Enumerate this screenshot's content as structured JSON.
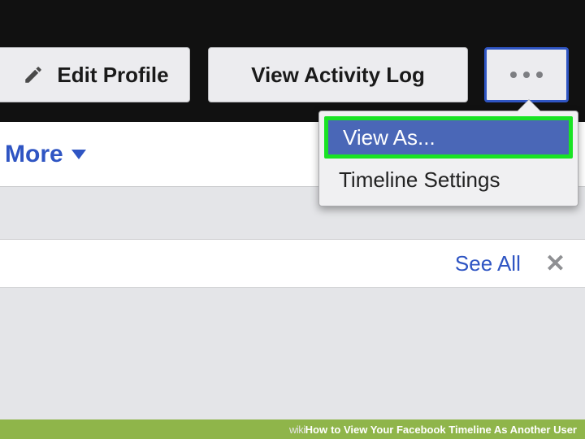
{
  "header": {
    "edit_label": "Edit Profile",
    "activity_label": "View Activity Log",
    "more_icon": "more-options",
    "pencil_icon": "pencil"
  },
  "tabs": {
    "more_label": "More"
  },
  "dropdown": {
    "items": [
      {
        "label": "View As...",
        "highlighted": true
      },
      {
        "label": "Timeline Settings",
        "highlighted": false
      }
    ]
  },
  "section": {
    "see_all_label": "See All",
    "close_icon": "close"
  },
  "caption": {
    "brand_a": "wiki",
    "brand_b": "How",
    "title": " to View Your Facebook Timeline As Another User"
  },
  "colors": {
    "fb_blue": "#2f55c3",
    "highlight_green": "#19e324",
    "menu_selected": "#4a67b7"
  }
}
